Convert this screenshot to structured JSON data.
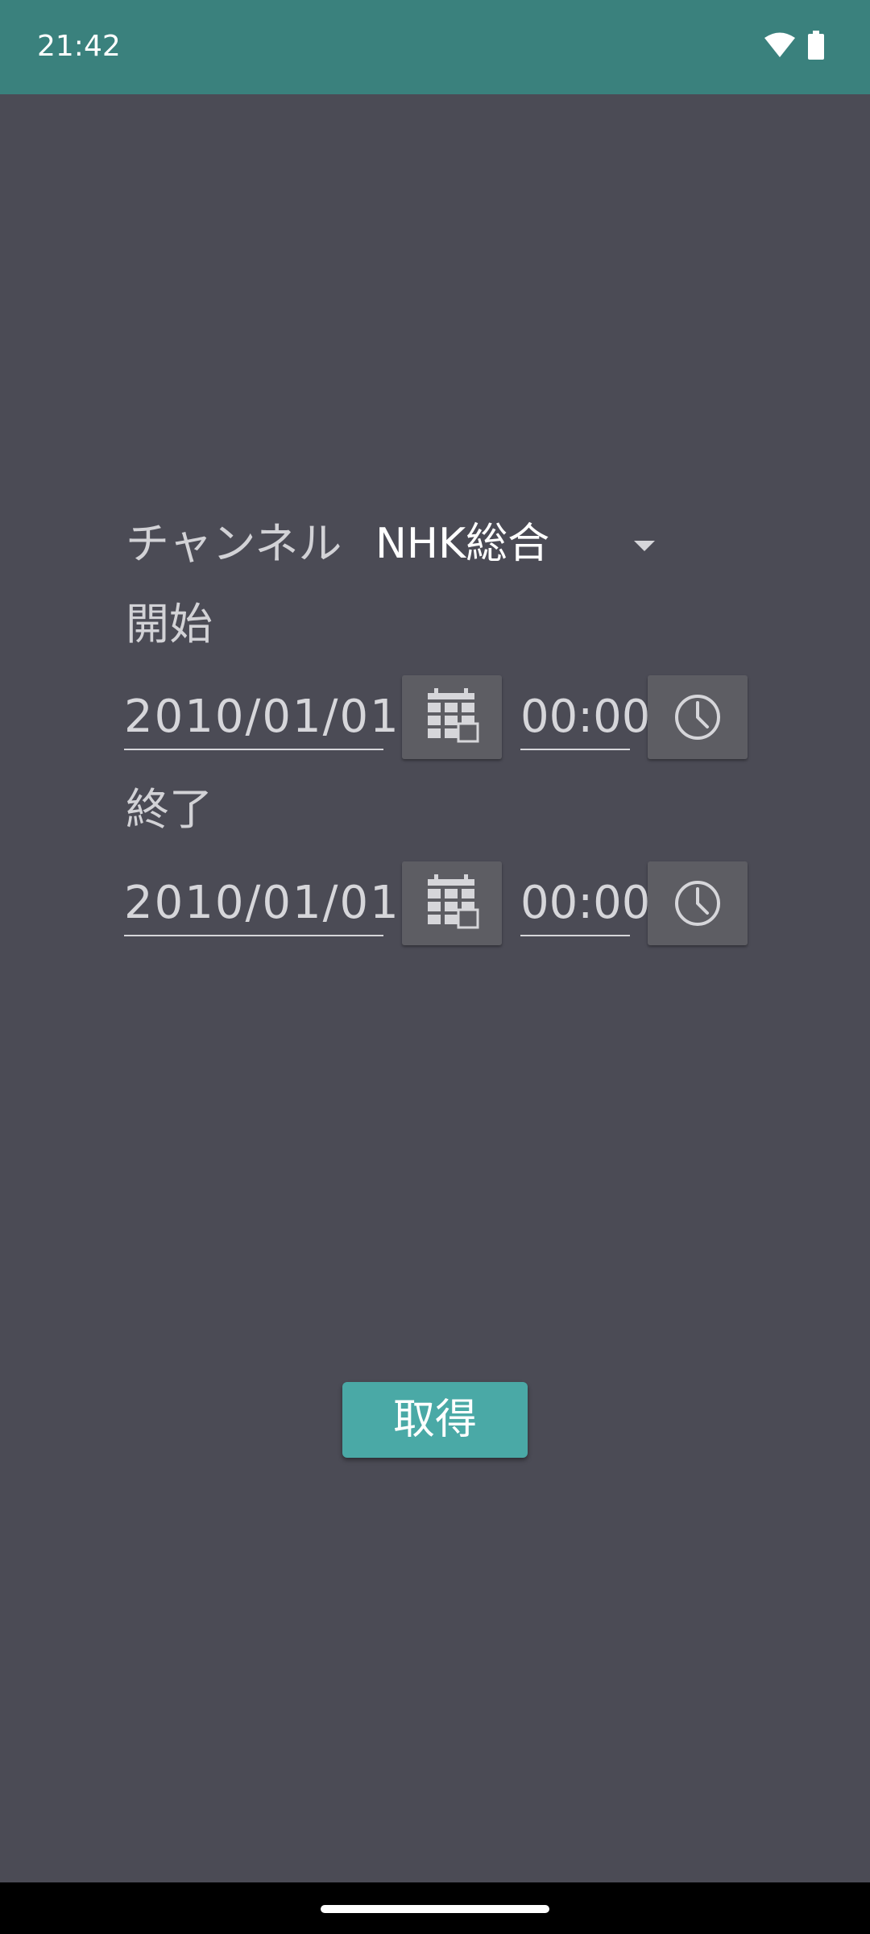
{
  "status_bar": {
    "time": "21:42",
    "icons": [
      "wifi-icon",
      "battery-icon"
    ]
  },
  "form": {
    "channel_label": "チャンネル",
    "channel_value": "NHK総合",
    "start_label": "開始",
    "start_date": "2010/01/01",
    "start_time": "00:00",
    "end_label": "終了",
    "end_date": "2010/01/01",
    "end_time": "00:00",
    "date_picker_icon": "calendar-icon",
    "time_picker_icon": "clock-icon"
  },
  "actions": {
    "fetch_label": "取得"
  },
  "colors": {
    "background": "#4b4b55",
    "status_bar": "#3a817d",
    "accent_button": "#4aa9a6",
    "icon_button": "#5d5d63"
  }
}
